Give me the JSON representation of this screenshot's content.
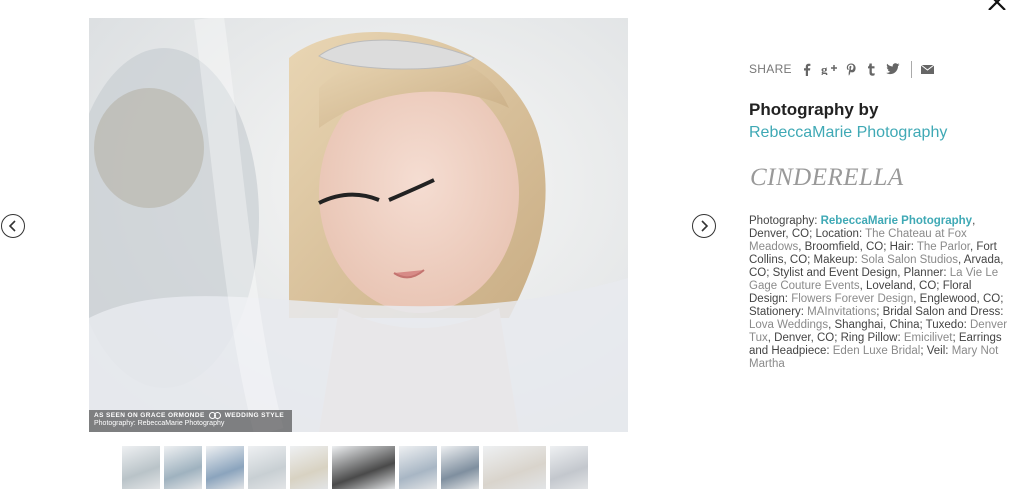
{
  "close_icon": "close-icon",
  "nav": {
    "prev_icon": "chevron-left-icon",
    "next_icon": "chevron-right-icon"
  },
  "photo": {
    "badge_line1_left": "AS SEEN ON GRACE ORMONDE",
    "badge_line1_right": "WEDDING STYLE",
    "badge_line2": "Photography: RebeccaMarie Photography"
  },
  "thumbnails": [
    {
      "name": "thumbnail-1",
      "w": 38,
      "tone": "#b9c3c8"
    },
    {
      "name": "thumbnail-2",
      "w": 38,
      "tone": "#9fb2bf"
    },
    {
      "name": "thumbnail-3",
      "w": 38,
      "tone": "#8ba4bd"
    },
    {
      "name": "thumbnail-4",
      "w": 38,
      "tone": "#c8cfd3"
    },
    {
      "name": "thumbnail-5",
      "w": 38,
      "tone": "#d8d2c2"
    },
    {
      "name": "thumbnail-6",
      "w": 63,
      "tone": "#4a4a4a"
    },
    {
      "name": "thumbnail-7",
      "w": 38,
      "tone": "#a8b6c4"
    },
    {
      "name": "thumbnail-8",
      "w": 38,
      "tone": "#7f8f9f"
    },
    {
      "name": "thumbnail-9",
      "w": 63,
      "tone": "#d9d4cc"
    },
    {
      "name": "thumbnail-10",
      "w": 38,
      "tone": "#c3c7cd"
    }
  ],
  "share": {
    "label": "SHARE",
    "icons": [
      "facebook-icon",
      "google-plus-icon",
      "pinterest-icon",
      "tumblr-icon",
      "twitter-icon",
      "email-icon"
    ]
  },
  "side": {
    "photo_by": "Photography by",
    "photographer": "RebeccaMarie Photography",
    "title": "CINDERELLA"
  },
  "credits": {
    "p1_label": "Photography: ",
    "p1_link": "RebeccaMarie Photography",
    "p1_after": ", Denver, CO; Location: ",
    "loc_link": "The Chateau at Fox Meadows",
    "loc_after": ", Broomfield, CO; Hair: ",
    "hair_link": "The Parlor",
    "hair_after": ", Fort Collins, CO; Makeup: ",
    "makeup_link": "Sola Salon Studios",
    "makeup_after": ", Arvada, CO; Stylist and Event Design, Planner: ",
    "planner_link": "La Vie Le Gage Couture Events",
    "planner_after": ", Loveland, CO; Floral Design: ",
    "floral_link": "Flowers Forever Design",
    "floral_after": ", Englewood, CO; Stationery: ",
    "stationery_link": "MAInvitations",
    "stationery_after": "; Bridal Salon and Dress: ",
    "dress_link": "Lova Weddings",
    "dress_after": ", Shanghai, China; Tuxedo: ",
    "tux_link": "Denver Tux",
    "tux_after": ", Denver, CO; Ring Pillow: ",
    "pillow_link": "Emicilivet",
    "pillow_after": "; Earrings and Headpiece: ",
    "earrings_link": "Eden Luxe Bridal",
    "earrings_after": "; Veil: ",
    "veil_link": "Mary Not Martha"
  }
}
